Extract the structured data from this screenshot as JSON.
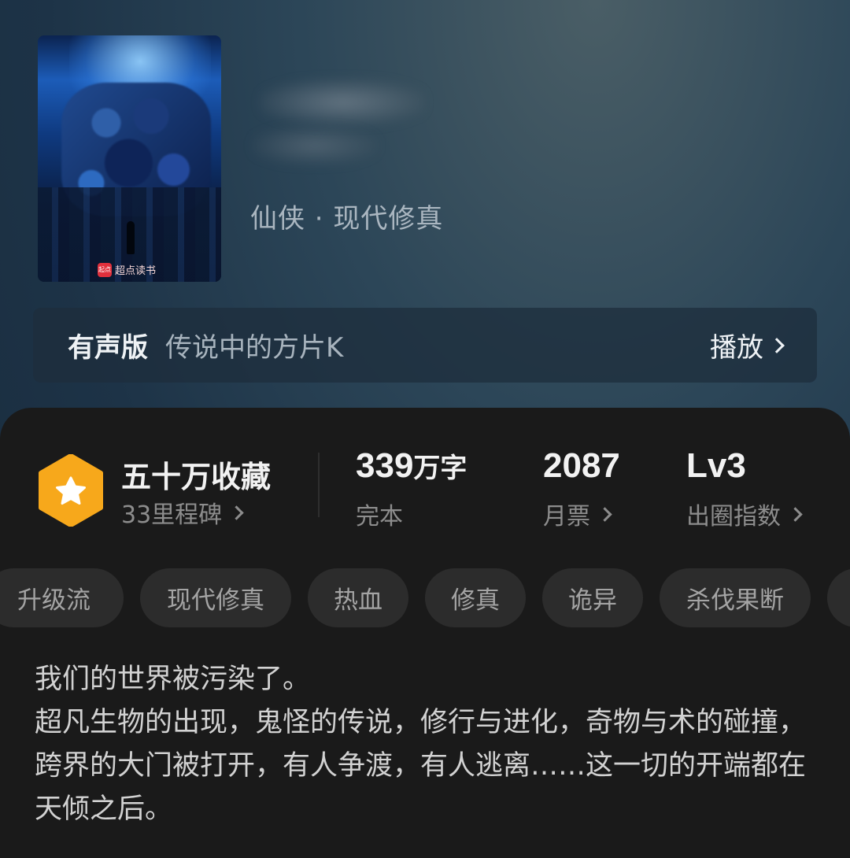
{
  "book": {
    "genre": "仙侠 · 现代修真",
    "cover_brand": "超点读书",
    "cover_brand_mark": "起点"
  },
  "audio": {
    "label": "有声版",
    "narrator": "传说中的方片K",
    "play_label": "播放"
  },
  "stats": {
    "collection_title": "五十万收藏",
    "milestone": "33里程碑",
    "word_count_number": "339",
    "word_count_unit": "万字",
    "status": "完本",
    "monthly_tickets": "2087",
    "monthly_tickets_label": "月票",
    "level": "Lv3",
    "level_label": "出圈指数"
  },
  "tags": [
    "升级流",
    "现代修真",
    "热血",
    "修真",
    "诡异",
    "杀伐果断"
  ],
  "description": "我们的世界被污染了。\n超凡生物的出现，鬼怪的传说，修行与进化，奇物与术的碰撞，跨界的大门被打开，有人争渡，有人逃离……这一切的开端都在天倾之后。",
  "colors": {
    "badge_orange": "#f7a81b",
    "card_bg": "#1a1a1a",
    "tag_bg": "#2c2c2c"
  },
  "icons": {
    "badge": "star-hexagon-icon",
    "chevron": "chevron-right-icon"
  }
}
